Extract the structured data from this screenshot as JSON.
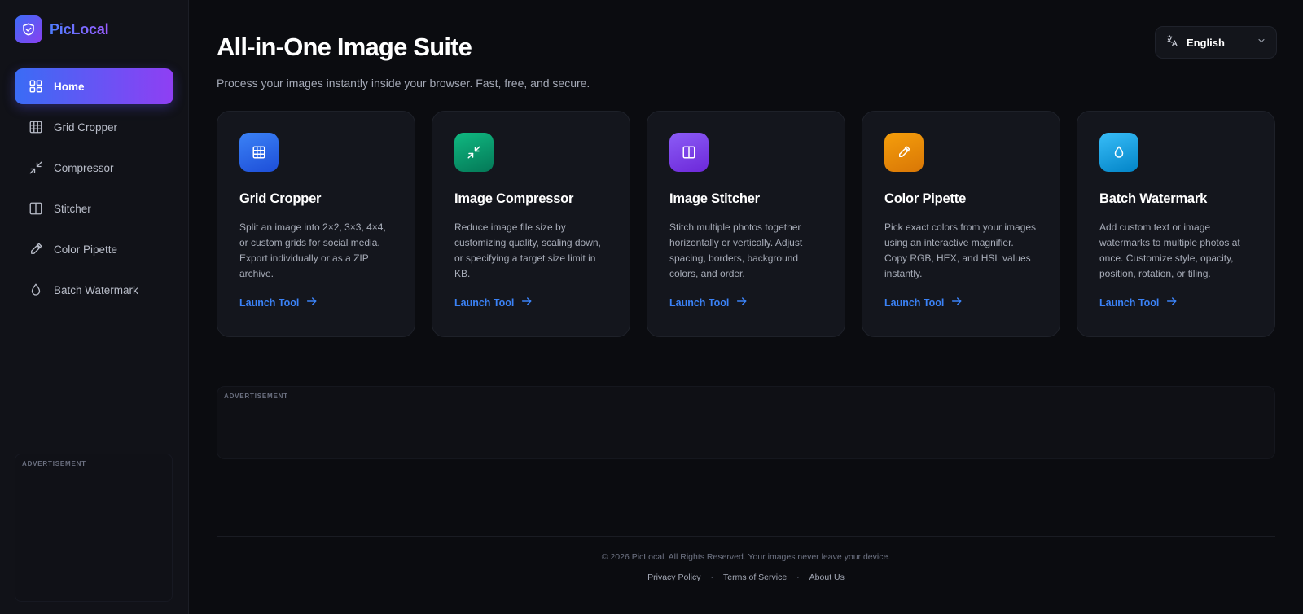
{
  "brand": {
    "name": "PicLocal",
    "logo_icon": "shield-icon"
  },
  "sidebar": {
    "items": [
      {
        "label": "Home",
        "icon": "grid-four-icon",
        "active": true
      },
      {
        "label": "Grid Cropper",
        "icon": "grid-nine-icon",
        "active": false
      },
      {
        "label": "Compressor",
        "icon": "compress-arrows-icon",
        "active": false
      },
      {
        "label": "Stitcher",
        "icon": "columns-icon",
        "active": false
      },
      {
        "label": "Color Pipette",
        "icon": "eyedropper-icon",
        "active": false
      },
      {
        "label": "Batch Watermark",
        "icon": "droplet-icon",
        "active": false
      }
    ],
    "ad_label": "ADVERTISEMENT"
  },
  "header": {
    "title": "All-in-One Image Suite",
    "subtitle": "Process your images instantly inside your browser. Fast, free, and secure.",
    "language": {
      "selected": "English",
      "icon": "translate-icon"
    }
  },
  "tools": [
    {
      "title": "Grid Cropper",
      "description": "Split an image into 2×2, 3×3, 4×4, or custom grids for social media. Export individually or as a ZIP archive.",
      "link": "Launch Tool",
      "icon": "grid-nine-icon",
      "color_from": "#3b82f6",
      "color_to": "#1d4ed8"
    },
    {
      "title": "Image Compressor",
      "description": "Reduce image file size by customizing quality, scaling down, or specifying a target size limit in KB.",
      "link": "Launch Tool",
      "icon": "compress-arrows-icon",
      "color_from": "#10b981",
      "color_to": "#047857"
    },
    {
      "title": "Image Stitcher",
      "description": "Stitch multiple photos together horizontally or vertically. Adjust spacing, borders, background colors, and order.",
      "link": "Launch Tool",
      "icon": "columns-icon",
      "color_from": "#8b5cf6",
      "color_to": "#6d28d9"
    },
    {
      "title": "Color Pipette",
      "description": "Pick exact colors from your images using an interactive magnifier. Copy RGB, HEX, and HSL values instantly.",
      "link": "Launch Tool",
      "icon": "eyedropper-icon",
      "color_from": "#f59e0b",
      "color_to": "#d97706"
    },
    {
      "title": "Batch Watermark",
      "description": "Add custom text or image watermarks to multiple photos at once. Customize style, opacity, position, rotation, or tiling.",
      "link": "Launch Tool",
      "icon": "droplet-icon",
      "color_from": "#38bdf8",
      "color_to": "#0284c7"
    }
  ],
  "main_ad": {
    "label": "ADVERTISEMENT"
  },
  "footer": {
    "copyright": "© 2026 PicLocal. All Rights Reserved. Your images never leave your device.",
    "links": [
      "Privacy Policy",
      "Terms of Service",
      "About Us"
    ],
    "separator": "·"
  },
  "colors": {
    "accent": "#3b82f6",
    "accent_gradient_from": "#3a6cf5",
    "accent_gradient_to": "#8f3ff3"
  }
}
